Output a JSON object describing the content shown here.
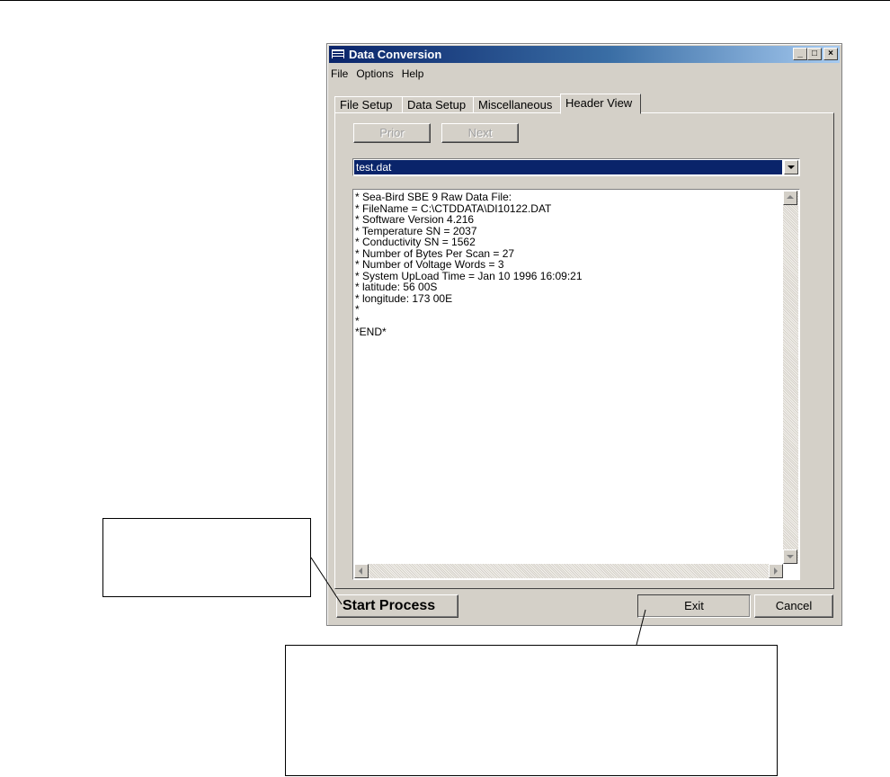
{
  "window": {
    "title": "Data Conversion",
    "controls": {
      "minimize": "_",
      "maximize": "□",
      "close": "×"
    }
  },
  "menu": [
    "File",
    "Options",
    "Help"
  ],
  "tabs": [
    {
      "label": "File Setup",
      "active": false
    },
    {
      "label": "Data Setup",
      "active": false
    },
    {
      "label": "Miscellaneous",
      "active": false
    },
    {
      "label": "Header View",
      "active": true
    }
  ],
  "nav": {
    "prior": "Prior",
    "next": "Next"
  },
  "file_select": {
    "value": "test.dat"
  },
  "header_text": "* Sea-Bird SBE 9 Raw Data File:\n* FileName = C:\\CTDDATA\\DI10122.DAT\n* Software Version 4.216\n* Temperature SN = 2037\n* Conductivity SN = 1562\n* Number of Bytes Per Scan = 27\n* Number of Voltage Words = 3\n* System UpLoad Time = Jan 10 1996 16:09:21\n* latitude: 56 00S\n* longitude: 173 00E\n*\n*\n*END*",
  "actions": {
    "start": "Start Process",
    "exit": "Exit",
    "cancel": "Cancel"
  },
  "colors": {
    "title_start": "#0a246a",
    "title_end": "#a6caf0",
    "face": "#d4d0c8"
  }
}
